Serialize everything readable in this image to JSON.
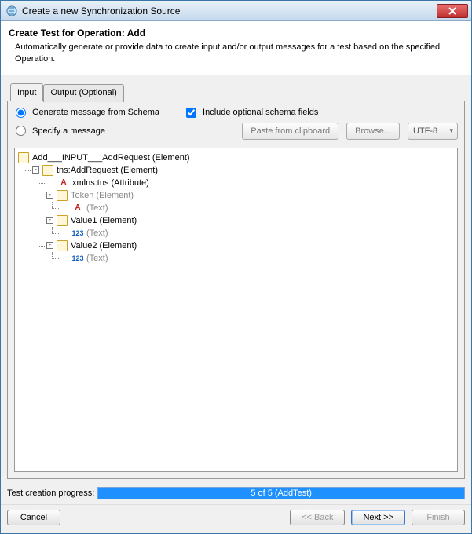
{
  "window": {
    "title": "Create a new Synchronization Source"
  },
  "header": {
    "title": "Create Test for Operation: Add",
    "description": "Automatically generate or provide data to create input and/or output messages for a test based on the specified Operation."
  },
  "tabs": {
    "input": "Input",
    "output": "Output (Optional)"
  },
  "options": {
    "generate_label": "Generate message from Schema",
    "include_label": "Include optional schema fields",
    "specify_label": "Specify a message",
    "paste_label": "Paste from clipboard",
    "browse_label": "Browse...",
    "encoding": "UTF-8"
  },
  "tree": {
    "root": "Add___INPUT___AddRequest (Element)",
    "addrequest": "tns:AddRequest (Element)",
    "xmlns": "xmlns:tns (Attribute)",
    "token": "Token (Element)",
    "token_text": "(Text)",
    "value1": "Value1 (Element)",
    "value1_text": "(Text)",
    "value2": "Value2 (Element)",
    "value2_text": "(Text)"
  },
  "progress": {
    "label": "Test creation progress:",
    "text": "5 of 5 (AddTest)"
  },
  "buttons": {
    "cancel": "Cancel",
    "back": "<< Back",
    "next": "Next >>",
    "finish": "Finish"
  }
}
